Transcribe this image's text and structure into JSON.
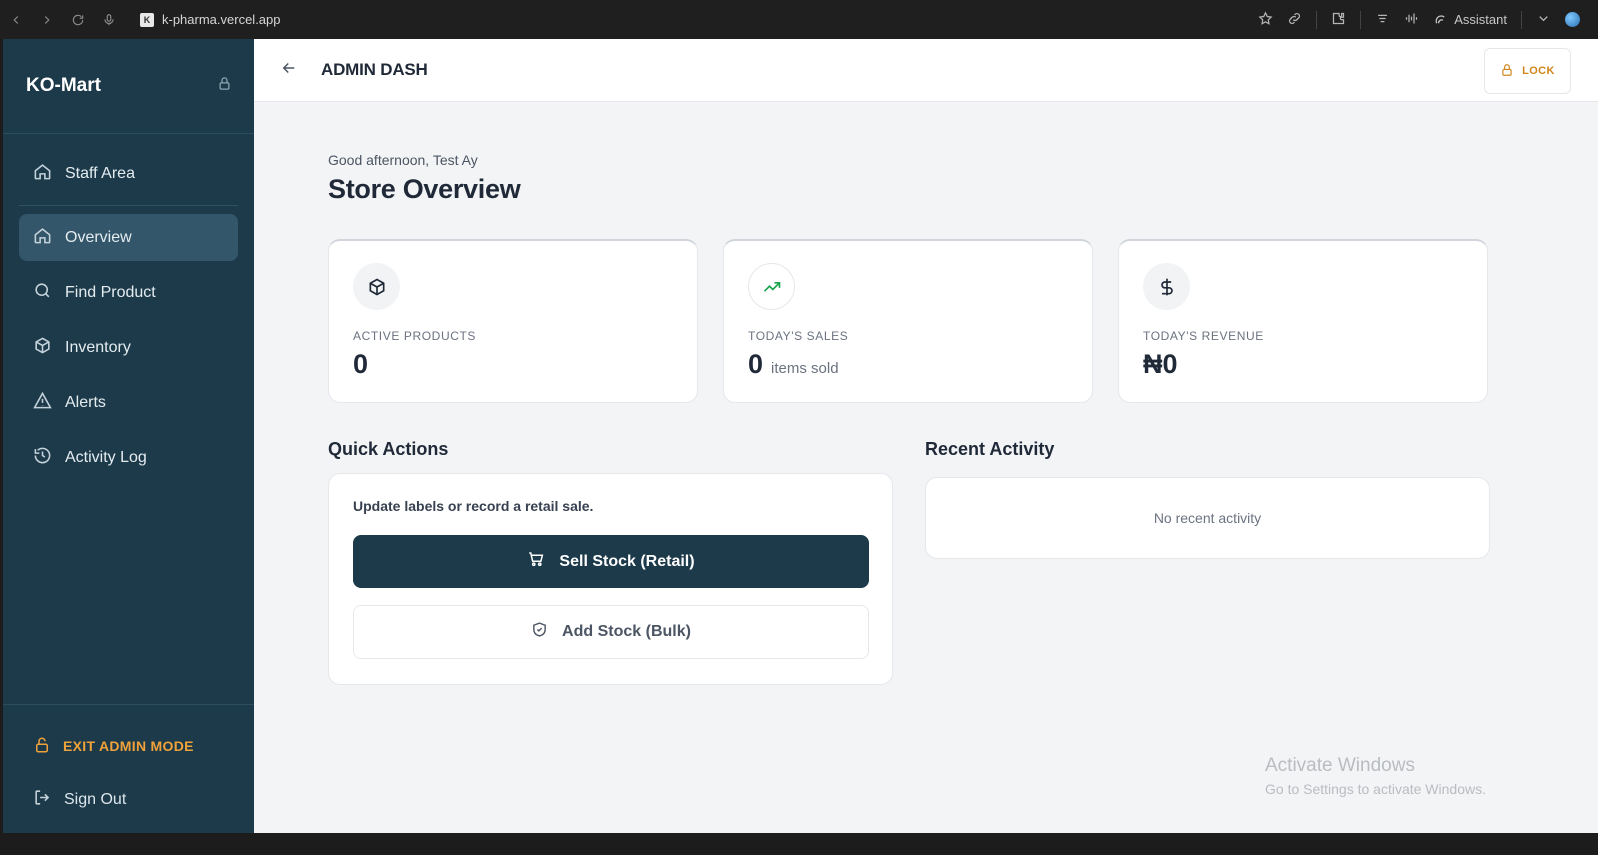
{
  "browser": {
    "url": "k-pharma.vercel.app",
    "favicon_letter": "K",
    "assistant_label": "Assistant"
  },
  "sidebar": {
    "brand": "KO-Mart",
    "items": [
      {
        "label": "Staff Area",
        "icon": "home-icon"
      },
      {
        "label": "Overview",
        "icon": "home-icon",
        "active": true
      },
      {
        "label": "Find Product",
        "icon": "search-icon"
      },
      {
        "label": "Inventory",
        "icon": "package-icon"
      },
      {
        "label": "Alerts",
        "icon": "warning-icon"
      },
      {
        "label": "Activity Log",
        "icon": "history-icon"
      }
    ],
    "exit_label": "EXIT ADMIN MODE",
    "signout_label": "Sign Out"
  },
  "header": {
    "title": "ADMIN DASH",
    "lock_label": "LOCK"
  },
  "main": {
    "greeting": "Good afternoon, Test Ay",
    "title": "Store Overview",
    "stats": [
      {
        "label": "ACTIVE PRODUCTS",
        "value": "0",
        "sub": "",
        "icon": "package-icon"
      },
      {
        "label": "TODAY'S SALES",
        "value": "0",
        "sub": "items sold",
        "icon": "trending-up-icon"
      },
      {
        "label": "TODAY'S REVENUE",
        "value": "₦0",
        "sub": "",
        "icon": "dollar-icon"
      }
    ],
    "quick_actions": {
      "title": "Quick Actions",
      "description": "Update labels or record a retail sale.",
      "primary_label": "Sell Stock (Retail)",
      "secondary_label": "Add Stock (Bulk)"
    },
    "recent_activity": {
      "title": "Recent Activity",
      "empty_text": "No recent activity"
    }
  },
  "watermark": {
    "line1": "Activate Windows",
    "line2": "Go to Settings to activate Windows."
  },
  "colors": {
    "sidebar_bg": "#1d3a4a",
    "active_item_bg": "#34566a",
    "accent_orange": "#f0a23a",
    "primary_button": "#1d3a4a",
    "sales_green": "#16a34a"
  }
}
